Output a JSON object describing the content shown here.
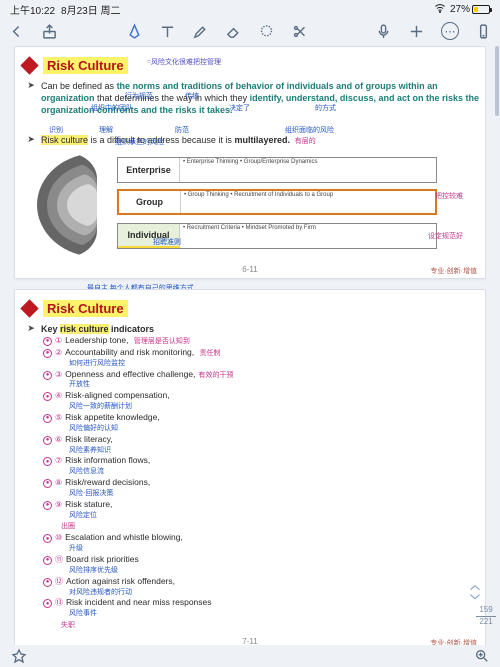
{
  "status": {
    "time": "上午10:22",
    "date": "8月23日 周二",
    "battery_pct": "27%"
  },
  "colors": {
    "accent": "#3a6ed8"
  },
  "nav": {
    "page_current": "159",
    "page_total": "221"
  },
  "footer_brand": "专业·创新·增值",
  "page1": {
    "title": "Risk Culture",
    "pagenum": "6-11",
    "bullet1": {
      "lead": "Can be defined as ",
      "teal": "the norms and traditions of behavior of individuals and of groups within an organization",
      "mid": " that determines the way in which they ",
      "teal2": "identify, understand, discuss, and act on the risks the organization confronts and the risks it takes."
    },
    "bullet2": {
      "pre": "Risk culture",
      "rest": " is a difficult to address because it is ",
      "bold": "multilayered.",
      "tail": " 有层的"
    },
    "diagram": {
      "ent_label": "Enterprise",
      "ent_desc": "• Enterprise Thinking\n• Group/Enterprise Dynamics",
      "grp_label": "Group",
      "grp_desc": "• Group Thinking\n• Recruitment of Individuals to a Group",
      "ind_label": "Individual",
      "ind_desc": "• Recruitment Criteria\n• Mindset Promoted by Firm"
    },
    "annots": {
      "title_right": "=风险文化很难把控管理",
      "b1_a": "行为规范",
      "b1_b": "传统",
      "b1_c": "决定了",
      "b1_d": "的方式",
      "b1_e": "组织中的团队",
      "b1_f": "识别",
      "b1_g": "理解",
      "b1_h": "防范",
      "b1_i": "组织面临的风险",
      "b1_j": "组织承担的风险",
      "d_top": "每个层级如何保持风险文化从上到下贯通",
      "d_grp_r": "把控较难",
      "d_ind_r": "设定规范好",
      "d_ind_l": "招聘准则",
      "d_bot": "最自主,每个人都有自己的思维方式"
    }
  },
  "page2": {
    "title": "Risk Culture",
    "pagenum": "7-11",
    "heading_pre": "Key ",
    "heading_hl": "risk culture",
    "heading_post": " indicators",
    "items": [
      {
        "n": "①",
        "text": "Leadership tone, ",
        "note_pink": "管理层是否认知到"
      },
      {
        "n": "②",
        "text": "Accountability and risk monitoring, ",
        "note_blue": "如何进行风险监控",
        "note_pink": "责任制"
      },
      {
        "n": "③",
        "text": "Openness and effective challenge,",
        "note_pink": "有效的干预",
        "note_blue": "开放性"
      },
      {
        "n": "④",
        "text": "Risk-aligned compensation,",
        "note_blue": "风险一致的薪酬计划"
      },
      {
        "n": "⑤",
        "text": "Risk appetite knowledge,",
        "note_blue": "风险偏好的认知"
      },
      {
        "n": "⑥",
        "text": "Risk literacy,",
        "note_blue": "风险素养知识"
      },
      {
        "n": "⑦",
        "text": "Risk information flows,",
        "note_blue": "风险信息流"
      },
      {
        "n": "⑧",
        "text": "Risk/reward decisions,",
        "note_blue": "风险·回报决策"
      },
      {
        "n": "⑨",
        "text": "Risk stature,",
        "note_blue": "风险定位",
        "note_pink2": "出圈"
      },
      {
        "n": "⑩",
        "text": "Escalation and whistle blowing,",
        "note_blue": "升级"
      },
      {
        "n": "⑪",
        "text": "Board risk priorities",
        "note_blue": "风险排序优先级"
      },
      {
        "n": "⑫",
        "text": "Action against risk offenders,",
        "note_blue": "对风险违规者的行动"
      },
      {
        "n": "⑬",
        "text": "Risk incident and near miss responses",
        "note_blue": "风险事件",
        "note_pink2": "失职"
      }
    ]
  }
}
